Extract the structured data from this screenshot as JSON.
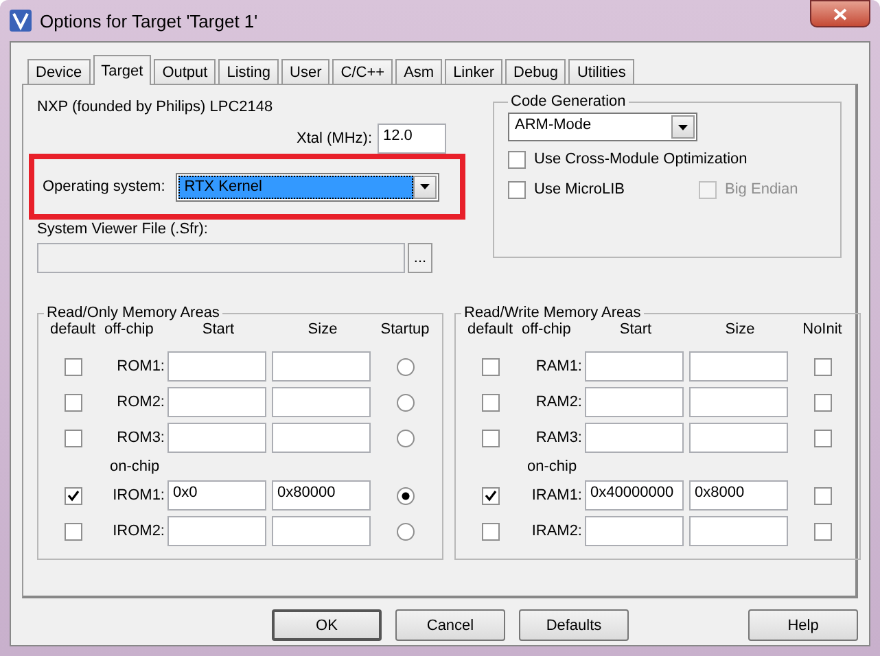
{
  "window": {
    "title": "Options for Target 'Target 1'"
  },
  "tabs": [
    {
      "label": "Device",
      "selected": false
    },
    {
      "label": "Target",
      "selected": true
    },
    {
      "label": "Output",
      "selected": false
    },
    {
      "label": "Listing",
      "selected": false
    },
    {
      "label": "User",
      "selected": false
    },
    {
      "label": "C/C++",
      "selected": false
    },
    {
      "label": "Asm",
      "selected": false
    },
    {
      "label": "Linker",
      "selected": false
    },
    {
      "label": "Debug",
      "selected": false
    },
    {
      "label": "Utilities",
      "selected": false
    }
  ],
  "device": "NXP (founded by Philips) LPC2148",
  "xtal": {
    "label": "Xtal (MHz):",
    "value": "12.0"
  },
  "operating_system": {
    "label": "Operating system:",
    "value": "RTX Kernel"
  },
  "system_viewer": {
    "label": "System Viewer File (.Sfr):",
    "browse": "..."
  },
  "code_generation": {
    "title": "Code Generation",
    "mode": "ARM-Mode",
    "options": [
      {
        "label": "Use Cross-Module Optimization",
        "checked": false,
        "disabled": false
      },
      {
        "label": "Use MicroLIB",
        "checked": false,
        "disabled": false
      },
      {
        "label": "Big Endian",
        "checked": false,
        "disabled": true
      }
    ]
  },
  "rom": {
    "title": "Read/Only Memory Areas",
    "columns": [
      "default",
      "off-chip",
      "Start",
      "Size",
      "Startup"
    ],
    "kind": "radio",
    "onchip_label": "on-chip",
    "offchip_rows": [
      {
        "name": "ROM1:",
        "default": false,
        "start": "",
        "size": "",
        "selected": false
      },
      {
        "name": "ROM2:",
        "default": false,
        "start": "",
        "size": "",
        "selected": false
      },
      {
        "name": "ROM3:",
        "default": false,
        "start": "",
        "size": "",
        "selected": false
      }
    ],
    "onchip_rows": [
      {
        "name": "IROM1:",
        "default": true,
        "start": "0x0",
        "size": "0x80000",
        "selected": true
      },
      {
        "name": "IROM2:",
        "default": false,
        "start": "",
        "size": "",
        "selected": false
      }
    ]
  },
  "ram": {
    "title": "Read/Write Memory Areas",
    "columns": [
      "default",
      "off-chip",
      "Start",
      "Size",
      "NoInit"
    ],
    "kind": "check",
    "onchip_label": "on-chip",
    "offchip_rows": [
      {
        "name": "RAM1:",
        "default": false,
        "start": "",
        "size": "",
        "noinit": false
      },
      {
        "name": "RAM2:",
        "default": false,
        "start": "",
        "size": "",
        "noinit": false
      },
      {
        "name": "RAM3:",
        "default": false,
        "start": "",
        "size": "",
        "noinit": false
      }
    ],
    "onchip_rows": [
      {
        "name": "IRAM1:",
        "default": true,
        "start": "0x40000000",
        "size": "0x8000",
        "noinit": false
      },
      {
        "name": "IRAM2:",
        "default": false,
        "start": "",
        "size": "",
        "noinit": false
      }
    ]
  },
  "buttons": [
    {
      "label": "OK",
      "default": true
    },
    {
      "label": "Cancel",
      "default": false
    },
    {
      "label": "Defaults",
      "default": false
    }
  ],
  "help_button": "Help"
}
